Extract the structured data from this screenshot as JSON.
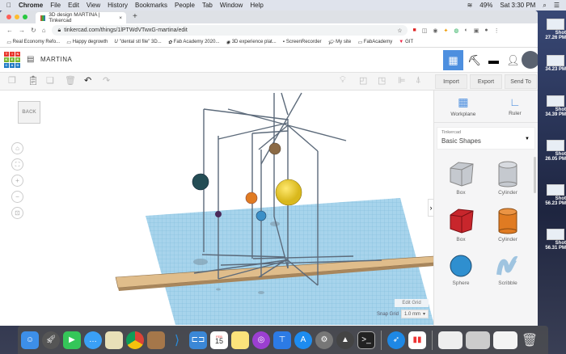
{
  "menubar": {
    "app": "Chrome",
    "items": [
      "File",
      "Edit",
      "View",
      "History",
      "Bookmarks",
      "People",
      "Tab",
      "Window",
      "Help"
    ],
    "battery": "49%",
    "clock": "Sat 3:30 PM"
  },
  "browser": {
    "tab_title": "3D design MARTINA | Tinkercad",
    "url": "tinkercad.com/things/1lPTWdVTwxG-martina/edit",
    "bookmarks": [
      "Real Economy Refo...",
      "Happy degrowth",
      "\"dental stl file\" 3D...",
      "Fab Academy 2020...",
      "3D experience plat...",
      "ScreenRecorder",
      "My site",
      "FabAcademy",
      "GIT"
    ]
  },
  "tinkercad": {
    "logo": "TIN KER CAD",
    "design_title": "MARTINA",
    "toolbar": {
      "import": "Import",
      "export": "Export",
      "send_to": "Send To"
    },
    "viewcube": "BACK",
    "edit_grid": "Edit Grid",
    "snap_grid_label": "Snap Grid",
    "snap_grid_value": "1.0 mm",
    "panel": {
      "workplane": "Workplane",
      "ruler": "Ruler",
      "library_label": "Tinkercad",
      "library_value": "Basic Shapes",
      "shapes": [
        {
          "name": "Box",
          "color": "#c5c9cf"
        },
        {
          "name": "Cylinder",
          "color": "#c5c9cf"
        },
        {
          "name": "Box",
          "color": "#c8262c"
        },
        {
          "name": "Cylinder",
          "color": "#e07b22"
        },
        {
          "name": "Sphere",
          "color": "#2f8fcf"
        },
        {
          "name": "Scribble",
          "color": "#9fc4e0"
        }
      ]
    }
  },
  "desktop": {
    "items": [
      {
        "l1": "Shot",
        "l2": "27.26 PM"
      },
      {
        "l1": "",
        "l2": "34.23 PM"
      },
      {
        "l1": "Shot",
        "l2": "34.39 PM"
      },
      {
        "l1": "Shot",
        "l2": "26.05 PM"
      },
      {
        "l1": "Shot",
        "l2": "56.23 PM"
      },
      {
        "l1": "Shot",
        "l2": "56.31 PM"
      }
    ]
  },
  "dock": {
    "calendar_day": "15",
    "calendar_month": "FEB"
  }
}
